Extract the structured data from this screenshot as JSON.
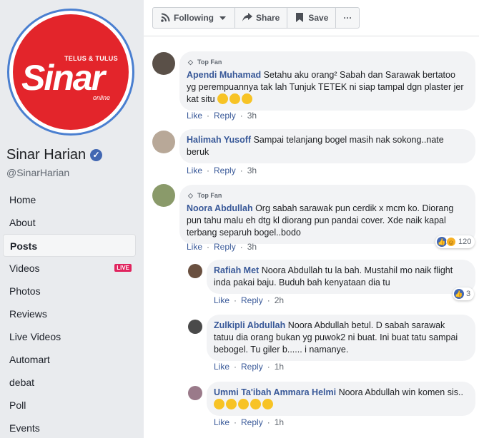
{
  "page": {
    "logo_tag": "TELUS & TULUS",
    "logo_word": "Sinar",
    "logo_sub": "online",
    "name": "Sinar Harian",
    "handle": "@SinarHarian"
  },
  "nav": [
    {
      "label": "Home",
      "active": false
    },
    {
      "label": "About",
      "active": false
    },
    {
      "label": "Posts",
      "active": true
    },
    {
      "label": "Videos",
      "active": false,
      "badge": "LIVE"
    },
    {
      "label": "Photos",
      "active": false
    },
    {
      "label": "Reviews",
      "active": false
    },
    {
      "label": "Live Videos",
      "active": false
    },
    {
      "label": "Automart",
      "active": false
    },
    {
      "label": "debat",
      "active": false
    },
    {
      "label": "Poll",
      "active": false
    },
    {
      "label": "Events",
      "active": false
    }
  ],
  "toolbar": {
    "following": "Following",
    "share": "Share",
    "save": "Save",
    "more": "···"
  },
  "actions": {
    "like": "Like",
    "reply": "Reply"
  },
  "comments": [
    {
      "topfan": "Top Fan",
      "author": "Apendi Muhamad",
      "text": "Setahu aku orang² Sabah dan Sarawak bertatoo yg perempuannya tak lah Tunjuk TETEK ni siap tampal dgn plaster jer kat situ",
      "time": "3h"
    },
    {
      "author": "Halimah Yusoff",
      "text": "Sampai telanjang bogel masih nak sokong..nate beruk",
      "time": "3h"
    },
    {
      "topfan": "Top Fan",
      "author": "Noora Abdullah",
      "text": "Org sabah sarawak pun cerdik x mcm ko. Diorang pun tahu malu eh dtg kl diorang pun pandai cover. Xde naik kapal terbang separuh bogel..bodo",
      "time": "3h",
      "reactions": "120"
    }
  ],
  "replies": [
    {
      "author": "Rafiah Met",
      "text": "Noora Abdullah tu la bah. Mustahil mo naik flight inda pakai baju. Buduh bah kenyataan dia tu",
      "time": "2h",
      "reactions": "3"
    },
    {
      "author": "Zulkipli Abdullah",
      "text": "Noora Abdullah betul. D sabah sarawak tatuu dia orang bukan yg puwok2 ni buat. Ini buat tatu sampai bebogel. Tu giler b...... i namanye.",
      "time": "1h"
    },
    {
      "author": "Ummi Ta'ibah Ammara Helmi",
      "text": "Noora Abdullah win komen sis..",
      "time": "1h"
    }
  ],
  "colors": {
    "link": "#385898",
    "logo_red": "#e3252b",
    "verified": "#4267b2"
  }
}
